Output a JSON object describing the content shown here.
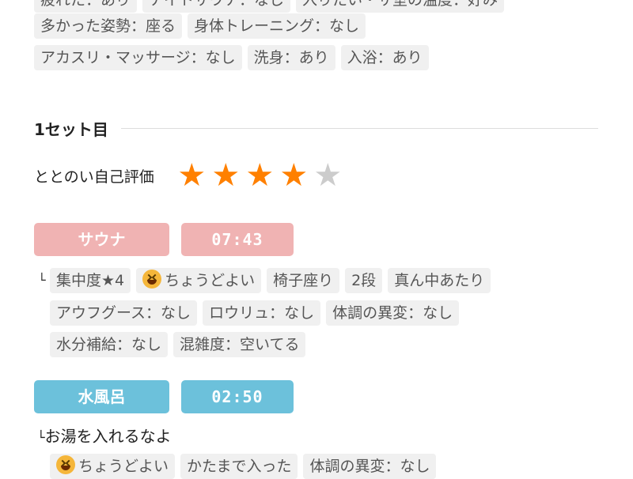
{
  "top_tags": {
    "row0": [
      "疲れた：あり",
      "ナイトサウナ：なし",
      "入りたい・サ室の温度：好み"
    ],
    "row1": [
      "多かった姿勢：座る",
      "身体トレーニング：なし"
    ],
    "row2": [
      "アカスリ・マッサージ：なし",
      "洗身：あり",
      "入浴：あり"
    ]
  },
  "set": {
    "title": "1セット目",
    "rating_label": "ととのい自己評価",
    "rating_value": 4,
    "rating_max": 5
  },
  "sauna": {
    "label": "サウナ",
    "time": "07:43",
    "branch": "└",
    "tags_row1": [
      "集中度★4",
      "ちょうどよい",
      "椅子座り",
      "2段",
      "真ん中あたり"
    ],
    "tags_row2": [
      "アウフグース：なし",
      "ロウリュ：なし",
      "体調の異変：なし"
    ],
    "tags_row3": [
      "水分補給：なし",
      "混雑度：空いてる"
    ]
  },
  "water": {
    "label": "水風呂",
    "time": "02:50",
    "note_branch": "└",
    "note": "お湯を入れるなよ",
    "tags_row1": [
      "ちょうどよい",
      "かたまで入った",
      "体調の異変：なし"
    ]
  },
  "colors": {
    "sauna_pill": "#f0b3b3",
    "water_pill": "#6cc1db",
    "star_on": "#ff8000",
    "star_off": "#cccccc",
    "tag_bg": "#f0f0f0"
  },
  "icons": {
    "mood": "grinning-face-emoji",
    "star": "star-icon"
  }
}
